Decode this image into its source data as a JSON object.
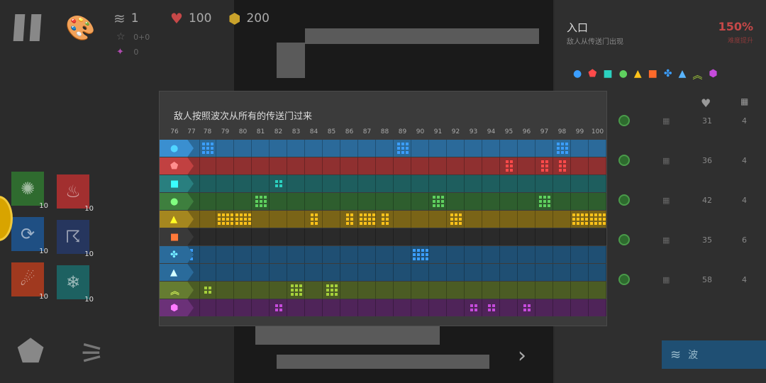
{
  "hud": {
    "wave_value": "1",
    "star_value": "0+0",
    "bonus_value": "0",
    "lives_value": "100",
    "coins_value": "200"
  },
  "side_panel": {
    "title": "入口",
    "subtitle": "敌人从传送门出现",
    "percent": "150%",
    "percent_sub": "难度提升",
    "header_lives_icon": "heart-icon",
    "rows": [
      {
        "hp": "31",
        "count": "4"
      },
      {
        "hp": "36",
        "count": "4"
      },
      {
        "hp": "42",
        "count": "4"
      },
      {
        "hp": "35",
        "count": "6"
      },
      {
        "hp": "58",
        "count": "4"
      }
    ],
    "wave_button": "波"
  },
  "cards": [
    {
      "icon": "cloud-burst-icon",
      "level": "10",
      "color": "#2f6b2f"
    },
    {
      "icon": "fire-icon",
      "level": "10",
      "color": "#a22f2f"
    },
    {
      "icon": "vortex-icon",
      "level": "10",
      "color": "#1f4f83"
    },
    {
      "icon": "storm-icon",
      "level": "10",
      "color": "#26365e"
    },
    {
      "icon": "meteor-icon",
      "level": "10",
      "color": "#a0391f"
    },
    {
      "icon": "blizzard-icon",
      "level": "10",
      "color": "#1d6161"
    }
  ],
  "modal": {
    "title": "敌人按照波次从所有的传送门过来",
    "waves": [
      "76",
      "77",
      "78",
      "79",
      "80",
      "81",
      "82",
      "83",
      "84",
      "85",
      "86",
      "87",
      "88",
      "89",
      "90",
      "91",
      "92",
      "93",
      "94",
      "95",
      "96",
      "97",
      "98",
      "99",
      "100"
    ],
    "rows": [
      {
        "enemy": "circle",
        "color": "#2b6a9a",
        "dot": "#3b9eff",
        "marks": {
          "78": 9,
          "89": 9,
          "98": 9
        }
      },
      {
        "enemy": "pentagon",
        "color": "#8f3030",
        "dot": "#ff4a4a",
        "marks": {
          "95": 6,
          "97": 6,
          "98": 6
        }
      },
      {
        "enemy": "square",
        "color": "#1e5e5e",
        "dot": "#2bd1c0",
        "marks": {
          "82": 4
        }
      },
      {
        "enemy": "circle-green",
        "color": "#2e5e2e",
        "dot": "#5fd15f",
        "marks": {
          "81": 9,
          "91": 9,
          "97": 9
        }
      },
      {
        "enemy": "triangle",
        "color": "#7a6417",
        "dot": "#ffc21a",
        "marks": {
          "79": 12,
          "80": 12,
          "84": 6,
          "86": 6,
          "87": 12,
          "88": 6,
          "92": 9,
          "99": 12,
          "100": 12
        }
      },
      {
        "enemy": "square-red",
        "color": "#2a2a2a",
        "dot": "#ff6a2a",
        "marks": {}
      },
      {
        "enemy": "clover",
        "color": "#1f4f73",
        "dot": "#3b9eff",
        "marks": {
          "77": 3,
          "90": 12
        }
      },
      {
        "enemy": "triangle-blue",
        "color": "#1f4f73",
        "dot": "#58b4ff",
        "marks": {}
      },
      {
        "enemy": "chevron",
        "color": "#4b5c24",
        "dot": "#a6d13b",
        "marks": {
          "78": 4,
          "83": 9,
          "85": 9
        }
      },
      {
        "enemy": "hexagon",
        "color": "#4f2459",
        "dot": "#c64bdc",
        "marks": {
          "82": 4,
          "93": 4,
          "94": 4,
          "96": 4
        }
      }
    ]
  },
  "colors": {
    "accent_blue": "#1f4f73",
    "lives_red": "#c64848",
    "coin_gold": "#c9a22b"
  }
}
